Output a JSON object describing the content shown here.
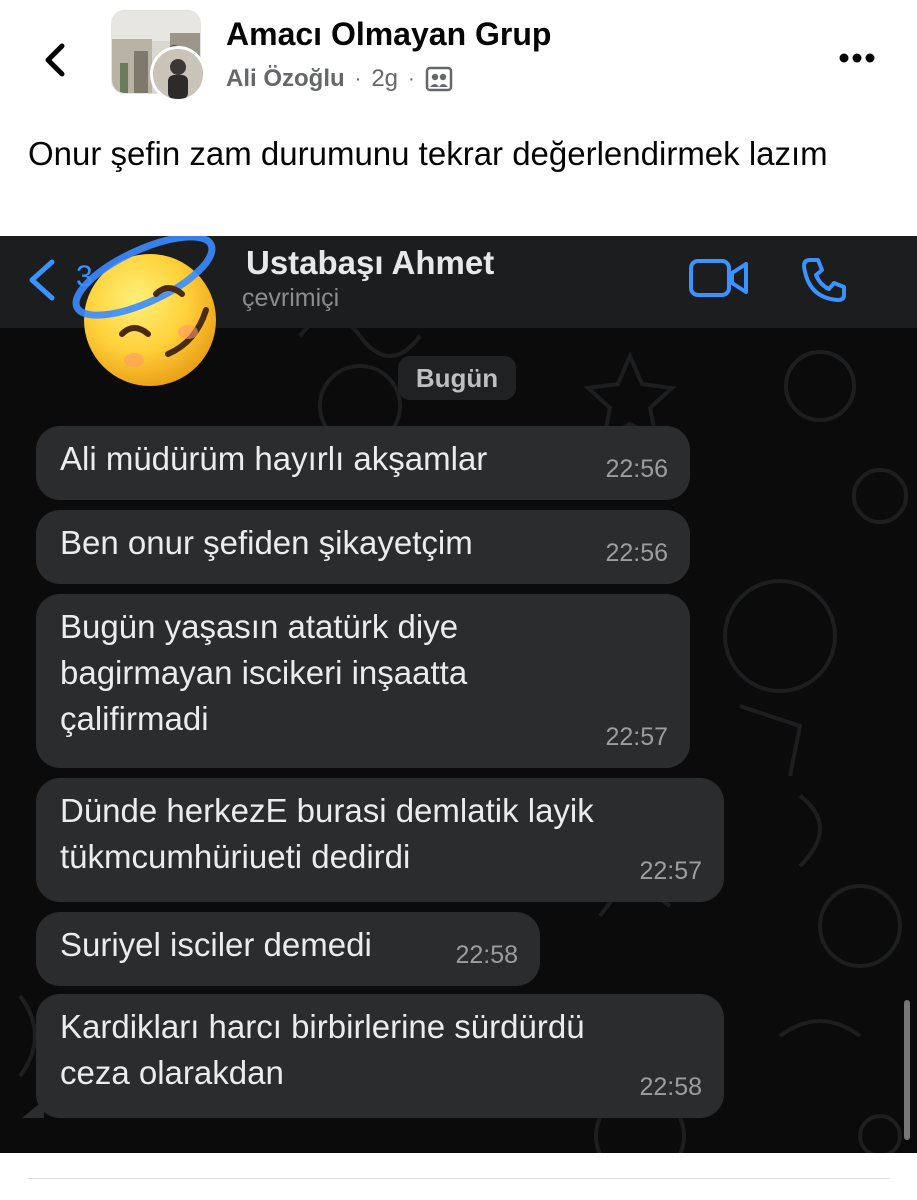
{
  "post_header": {
    "group_name": "Amacı Olmayan Grup",
    "author": "Ali Özoğlu",
    "time": "2g",
    "separator": "·",
    "back_icon": "chevron-left-icon",
    "more_icon": "ellipsis-icon",
    "privacy_icon": "group-members-icon"
  },
  "post": {
    "text": "Onur şefin zam durumunu tekrar değerlendirmek lazım"
  },
  "chat": {
    "back_count": "3",
    "contact_name": "Ustabaşı Ahmet",
    "contact_status": "çevrimiçi",
    "date_label": "Bugün",
    "sticker": "halo-smiling-face-emoji",
    "messages": [
      {
        "text": "Ali müdürüm hayırlı akşamlar",
        "time": "22:56"
      },
      {
        "text": "Ben onur şefiden  şikayetçim",
        "time": "22:56"
      },
      {
        "text": "Bugün yaşasın atatürk diye\nbagirmayan iscikeri inşaatta\nçalifirmadi",
        "time": "22:57"
      },
      {
        "text": "Dünde herkezE burasi demlatik layik\ntükmcumhüriueti dedirdi",
        "time": "22:57"
      },
      {
        "text": "Suriyel isciler demedi",
        "time": "22:58"
      },
      {
        "text": "Kardikları harcı birbirlerine sürdürdü\nceza olarakdan",
        "time": "22:58"
      }
    ]
  },
  "colors": {
    "chat_background": "#0b0b0b",
    "chat_bubble": "#2a2c2e",
    "accent_blue": "#3b93ff",
    "meta_gray": "#65676b"
  }
}
